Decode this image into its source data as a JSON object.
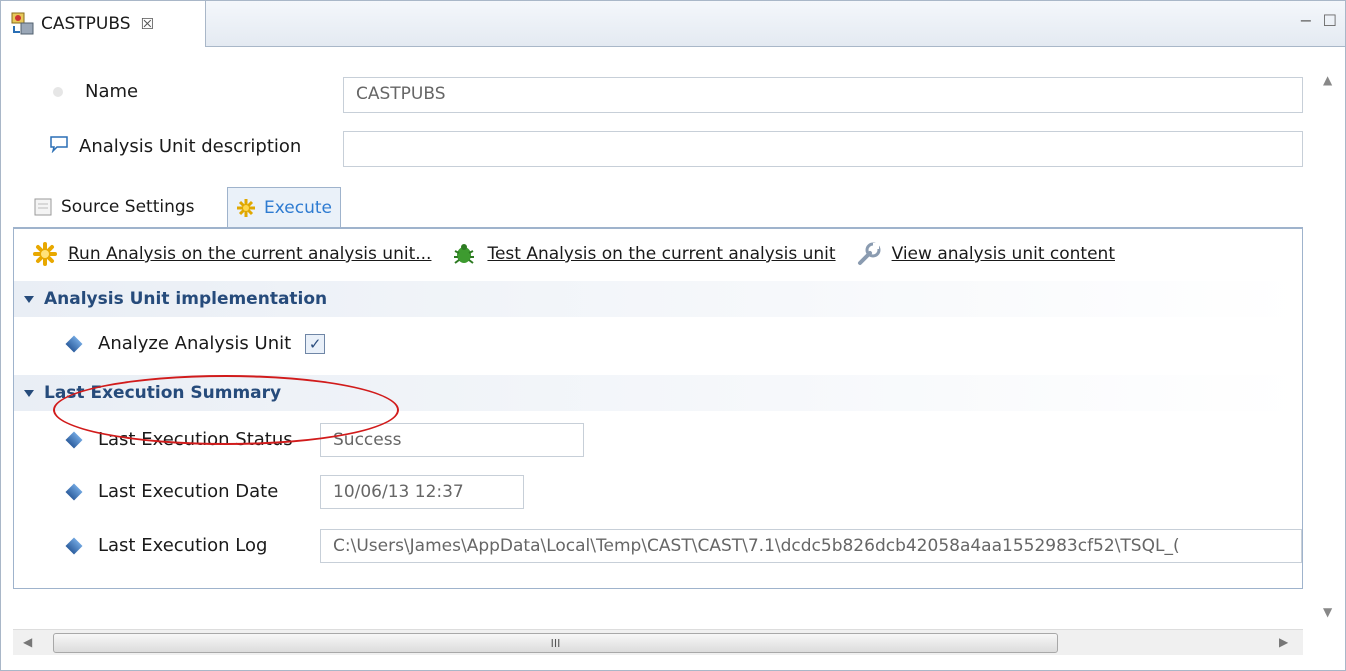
{
  "editor_tab": {
    "title": "CASTPUBS",
    "close_glyph": "☒",
    "icon": "database-gear-icon"
  },
  "window_controls": {
    "minimize": "−",
    "maximize": "☐"
  },
  "fields": {
    "name_label": "Name",
    "name_value": "CASTPUBS",
    "description_label": "Analysis Unit description",
    "description_value": ""
  },
  "subtabs": [
    {
      "label": "Source Settings",
      "icon": "document-icon",
      "active": false
    },
    {
      "label": "Execute",
      "icon": "sparkle-gear-icon",
      "active": true
    }
  ],
  "actions": [
    {
      "label": "Run Analysis on the current analysis unit...",
      "icon": "run-sparkle-icon"
    },
    {
      "label": "Test Analysis on the current analysis unit",
      "icon": "bug-icon"
    },
    {
      "label": "View analysis unit content",
      "icon": "wrench-icon"
    }
  ],
  "sections": {
    "implementation": {
      "title": "Analysis Unit implementation",
      "analyze_label": "Analyze Analysis Unit",
      "analyze_checked": true
    },
    "summary": {
      "title": "Last Execution Summary",
      "status_label": "Last Execution Status",
      "status_value": "Success",
      "date_label": "Last Execution Date",
      "date_value": "10/06/13 12:37",
      "log_label": "Last Execution Log",
      "log_value": "C:\\Users\\James\\AppData\\Local\\Temp\\CAST\\CAST\\7.1\\dcdc5b826dcb42058a4aa1552983cf52\\TSQL_("
    }
  },
  "scrollbar": {
    "thumb_grip": "III"
  },
  "colors": {
    "accent_red": "#d11b1b",
    "section_text": "#264b7b",
    "active_tab_text": "#2e7bd1"
  }
}
